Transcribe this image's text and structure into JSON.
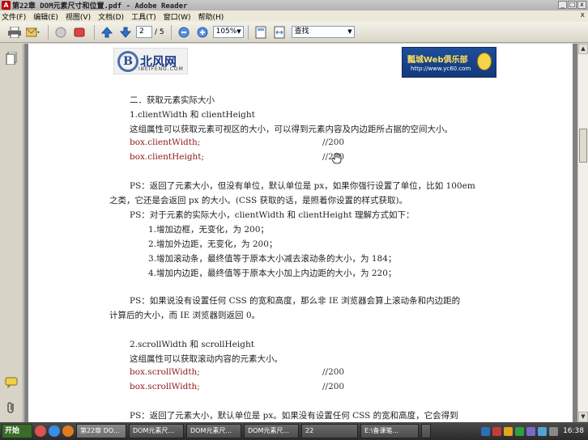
{
  "window": {
    "title": "第22章 DOM元素尺寸和位置.pdf - Adobe Reader",
    "controls": [
      "_",
      "□",
      "x"
    ]
  },
  "menubar": {
    "items": [
      "文件(F)",
      "编辑(E)",
      "视图(V)",
      "文档(D)",
      "工具(T)",
      "窗口(W)",
      "帮助(H)"
    ],
    "close": "x"
  },
  "toolbar": {
    "page_current": "2",
    "page_total": "/ 5",
    "zoom": "105%",
    "search_value": "查找"
  },
  "document": {
    "logo_left_text": "北风网",
    "logo_left_sub": "IBEIFENG.COM",
    "logo_right_title": "瓢城Web俱乐部",
    "logo_right_url": "http://www.yc60.com",
    "lines": {
      "l1": "二．获取元素实际大小",
      "l2": "1.clientWidth 和 clientHeight",
      "l3": "这组属性可以获取元素可视区的大小，可以得到元素内容及内边距所占据的空间大小。",
      "l4_code": "box.clientWidth;",
      "l4_cmt": "//200",
      "l5_code": "box.clientHeight;",
      "l5_cmt": "//200",
      "l6": "PS：返回了元素大小，但没有单位，默认单位是 px，如果你强行设置了单位，比如 100em",
      "l7": "之类，它还是会返回 px 的大小。(CSS 获取的话，是照着你设置的样式获取)。",
      "l8": "PS：对于元素的实际大小，clientWidth 和 clientHeight 理解方式如下：",
      "l9": "1.增加边框，无变化，为 200；",
      "l10": "2.增加外边距，无变化，为 200；",
      "l11": "3.增加滚动条，最终值等于原本大小减去滚动条的大小，为 184；",
      "l12": "4.增加内边距，最终值等于原本大小加上内边距的大小，为 220；",
      "l13": "PS：如果说没有设置任何 CSS 的宽和高度，那么非 IE 浏览器会算上滚动条和内边距的",
      "l14": "计算后的大小，而 IE 浏览器则返回 0。",
      "l15": "2.scrollWidth 和 scrollHeight",
      "l16": "这组属性可以获取滚动内容的元素大小。",
      "l17_code": "box.scrollWidth;",
      "l17_cmt": "//200",
      "l18_code": "box.scrollWidth;",
      "l18_cmt": "//200",
      "l19": "PS：返回了元素大小，默认单位是 px。如果没有设置任何 CSS 的宽和高度，它会得到"
    }
  },
  "taskbar": {
    "start_label": "开始",
    "tasks": [
      "第22章 DO...",
      "DOM元素尺...",
      "DOM元素尺...",
      "DOM元素尺...",
      "22",
      "E:\\备课笔...",
      ""
    ],
    "clock": "16:38"
  },
  "colors": {
    "code": "#8b1a1a",
    "page_bg": "#ffffff",
    "taskbar": "#3a3a3a"
  }
}
